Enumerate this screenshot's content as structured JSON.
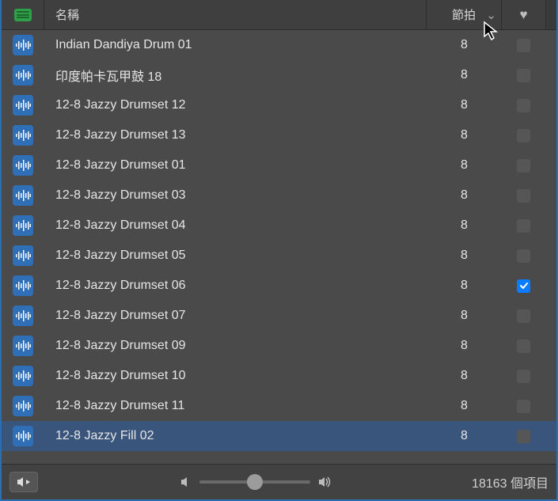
{
  "header": {
    "name_label": "名稱",
    "beats_label": "節拍",
    "sort_icon": "⌄",
    "fav_icon": "♥"
  },
  "rows": [
    {
      "name": "Indian Dandiya Drum 01",
      "beats": "8",
      "fav": false,
      "selected": false
    },
    {
      "name": "印度帕卡瓦甲鼓 18",
      "beats": "8",
      "fav": false,
      "selected": false
    },
    {
      "name": "12-8 Jazzy Drumset 12",
      "beats": "8",
      "fav": false,
      "selected": false
    },
    {
      "name": "12-8 Jazzy Drumset 13",
      "beats": "8",
      "fav": false,
      "selected": false
    },
    {
      "name": "12-8 Jazzy Drumset 01",
      "beats": "8",
      "fav": false,
      "selected": false
    },
    {
      "name": "12-8 Jazzy Drumset 03",
      "beats": "8",
      "fav": false,
      "selected": false
    },
    {
      "name": "12-8 Jazzy Drumset 04",
      "beats": "8",
      "fav": false,
      "selected": false
    },
    {
      "name": "12-8 Jazzy Drumset 05",
      "beats": "8",
      "fav": false,
      "selected": false
    },
    {
      "name": "12-8 Jazzy Drumset 06",
      "beats": "8",
      "fav": true,
      "selected": false
    },
    {
      "name": "12-8 Jazzy Drumset 07",
      "beats": "8",
      "fav": false,
      "selected": false
    },
    {
      "name": "12-8 Jazzy Drumset 09",
      "beats": "8",
      "fav": false,
      "selected": false
    },
    {
      "name": "12-8 Jazzy Drumset 10",
      "beats": "8",
      "fav": false,
      "selected": false
    },
    {
      "name": "12-8 Jazzy Drumset 11",
      "beats": "8",
      "fav": false,
      "selected": false
    },
    {
      "name": "12-8 Jazzy Fill 02",
      "beats": "8",
      "fav": false,
      "selected": true
    }
  ],
  "footer": {
    "count_text": "18163 個項目",
    "volume_percent": 50
  }
}
